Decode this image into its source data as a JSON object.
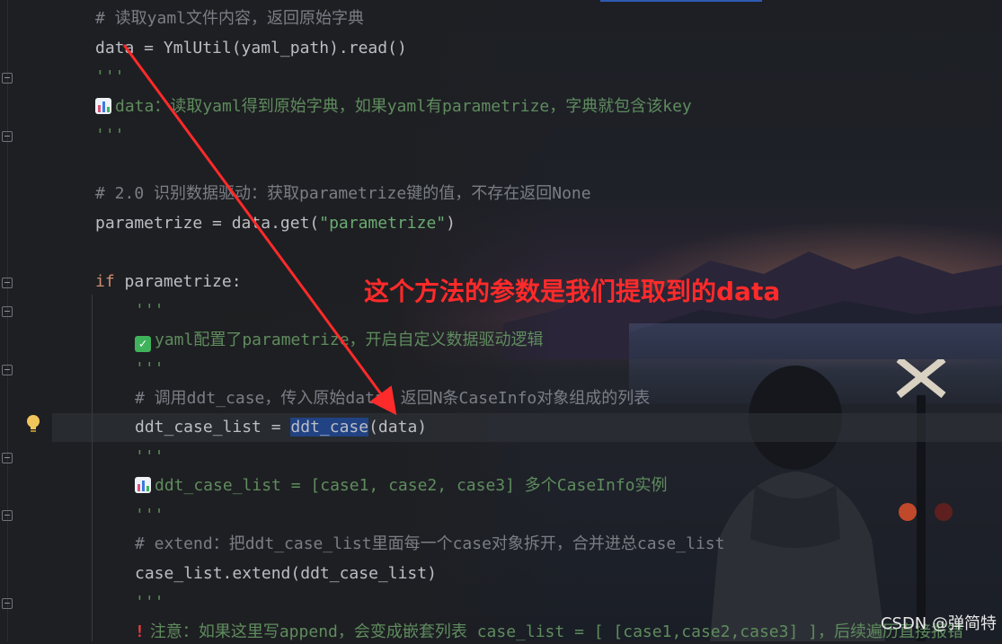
{
  "editor": {
    "lines": [
      {
        "text": "# 读取yaml文件内容，返回原始字典"
      },
      {
        "a": "data = YmlUtil(yaml_path).read()"
      },
      {
        "text": "'''"
      },
      {
        "text": "data：读取yaml得到原始字典，如果yaml有parametrize，字典就包含该key"
      },
      {
        "text": "'''"
      },
      {
        "text": "# 2.0 识别数据驱动：获取parametrize键的值，不存在返回None"
      },
      {
        "a": "parametrize = data.get(",
        "b": "\"parametrize\"",
        "c": ")"
      },
      {
        "kw": "if",
        "rest": " parametrize:"
      },
      {
        "text": "'''"
      },
      {
        "text": "yaml配置了parametrize，开启自定义数据驱动逻辑"
      },
      {
        "text": "'''"
      },
      {
        "text": "# 调用ddt_case，传入原始data，返回N条CaseInfo对象组成的列表"
      },
      {
        "a": "ddt_case_list = ",
        "hl": "ddt_case",
        "c": "(data)"
      },
      {
        "text": "'''"
      },
      {
        "text": "ddt_case_list = [case1, case2, case3] 多个CaseInfo实例"
      },
      {
        "text": "'''"
      },
      {
        "text": "# extend：把ddt_case_list里面每一个case对象拆开，合并进总case_list"
      },
      {
        "a": "case_list.extend(ddt_case_list)"
      },
      {
        "text": "'''"
      },
      {
        "text": "注意：如果这里写append，会变成嵌套列表 case_list = [ [case1,case2,case3] ]，后续遍历直接报错"
      }
    ]
  },
  "annotation": {
    "text": "这个方法的参数是我们提取到的data",
    "color": "#ff2a2a"
  },
  "watermark": "CSDN @弹简特",
  "icons": {
    "bar_chart": "bar-chart-emoji-icon",
    "check": "check-mark-emoji-icon",
    "warning": "exclamation-emoji-icon",
    "bulb": "lightbulb-icon",
    "fold": "fold-marker-icon"
  },
  "colors": {
    "comment": "#7a7e85",
    "docstring": "#5f8c5e",
    "string": "#6aab73",
    "keyword": "#cf8e6d",
    "selection": "#214283",
    "arrow": "#ff2a2a"
  }
}
